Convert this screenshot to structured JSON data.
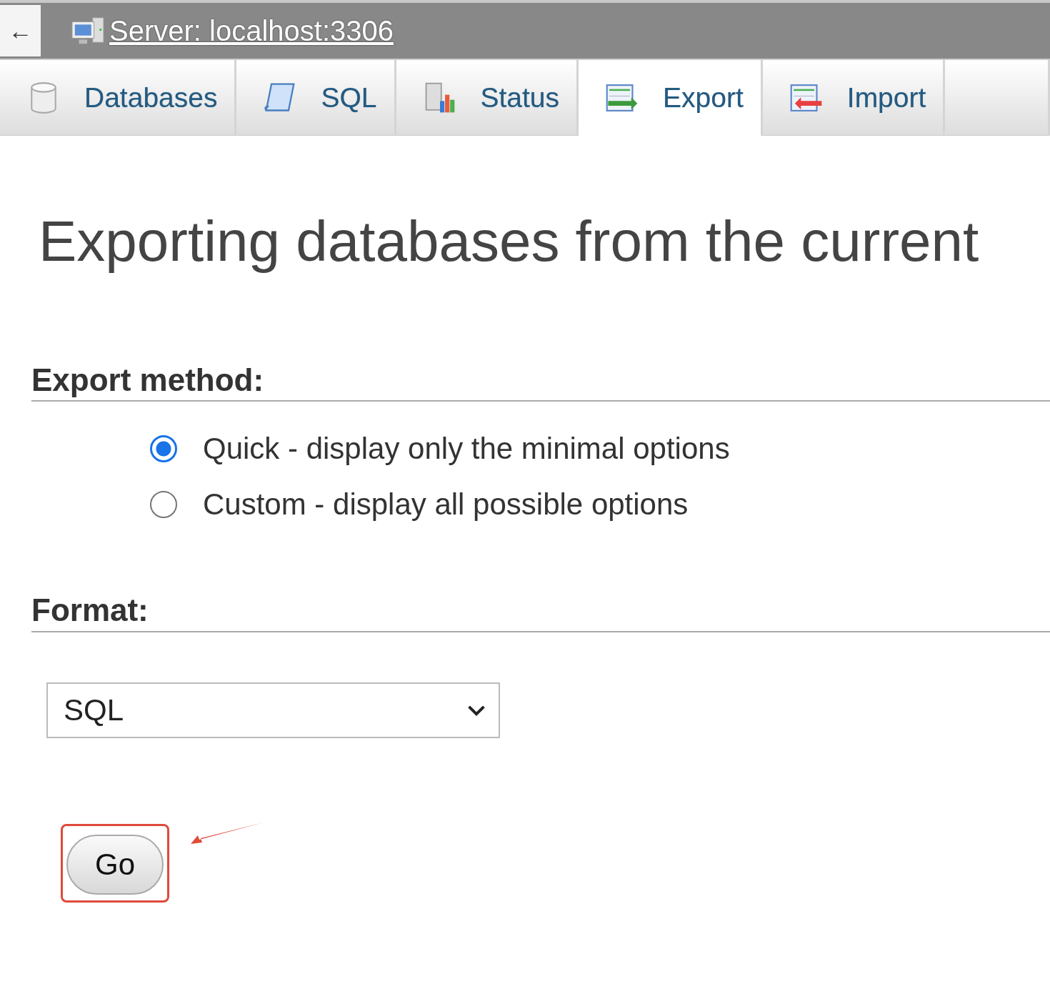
{
  "breadcrumb": {
    "back": "←",
    "server": "Server: localhost:3306"
  },
  "tabs": [
    {
      "label": "Databases",
      "kind": "database",
      "selected": false
    },
    {
      "label": "SQL",
      "kind": "sql",
      "selected": false
    },
    {
      "label": "Status",
      "kind": "status",
      "selected": false
    },
    {
      "label": "Export",
      "kind": "export",
      "selected": true
    },
    {
      "label": "Import",
      "kind": "import",
      "selected": false
    }
  ],
  "heading": "Exporting databases from the current",
  "export_method": {
    "legend": "Export method:",
    "options": [
      {
        "label": "Quick - display only the minimal options",
        "selected": true
      },
      {
        "label": "Custom - display all possible options",
        "selected": false
      }
    ]
  },
  "format": {
    "legend": "Format:",
    "value": "SQL"
  },
  "go_button": {
    "label": "Go",
    "highlighted": true
  }
}
